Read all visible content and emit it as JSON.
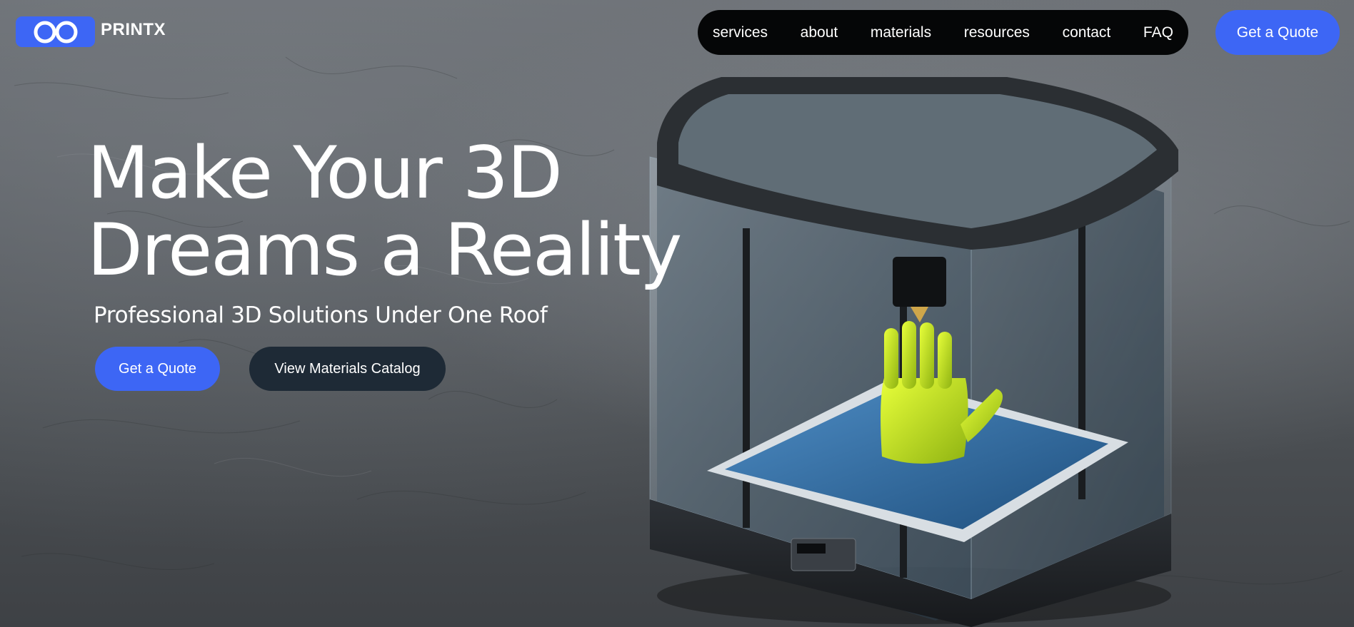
{
  "brand": {
    "name": "PRINTX",
    "logo_icon": "infinity-icon",
    "accent_color": "#3d66f5"
  },
  "nav": {
    "items": [
      {
        "label": "services"
      },
      {
        "label": "about"
      },
      {
        "label": "materials"
      },
      {
        "label": "resources"
      },
      {
        "label": "contact"
      },
      {
        "label": "FAQ"
      }
    ],
    "cta_label": "Get a Quote"
  },
  "hero": {
    "headline_line1": "Make Your 3D",
    "headline_line2": "Dreams a Reality",
    "subheadline": "Professional 3D Solutions Under One Roof",
    "primary_cta": "Get a Quote",
    "secondary_cta": "View Materials Catalog",
    "secondary_color": "#1e2a36"
  }
}
